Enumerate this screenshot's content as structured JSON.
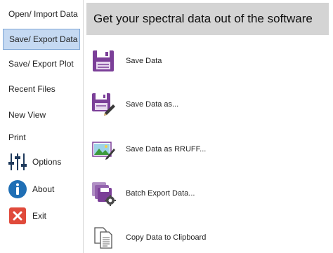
{
  "sidebar": {
    "items": [
      {
        "label": "Open/ Import Data"
      },
      {
        "label": "Save/ Export Data",
        "selected": true
      },
      {
        "label": "Save/ Export Plot"
      },
      {
        "label": "Recent Files"
      },
      {
        "label": "New View"
      },
      {
        "label": "Print"
      },
      {
        "label": "Options",
        "icon": "sliders-icon"
      },
      {
        "label": "About",
        "icon": "info-icon"
      },
      {
        "label": "Exit",
        "icon": "close-icon"
      }
    ]
  },
  "main": {
    "header_title": "Get your spectral data out of the software",
    "actions": [
      {
        "label": "Save Data",
        "icon": "floppy-disk-icon"
      },
      {
        "label": "Save Data as...",
        "icon": "floppy-disk-edit-icon"
      },
      {
        "label": "Save Data as RRUFF...",
        "icon": "image-edit-icon"
      },
      {
        "label": "Batch Export Data...",
        "icon": "batch-export-icon"
      },
      {
        "label": "Copy Data to Clipboard",
        "icon": "clipboard-copy-icon"
      }
    ]
  },
  "colors": {
    "selected_bg": "#c5d9f2",
    "accent_purple": "#7b3f98",
    "info_blue": "#1f6fb5",
    "exit_red": "#e04a3b",
    "header_bg": "#d4d4d4"
  }
}
